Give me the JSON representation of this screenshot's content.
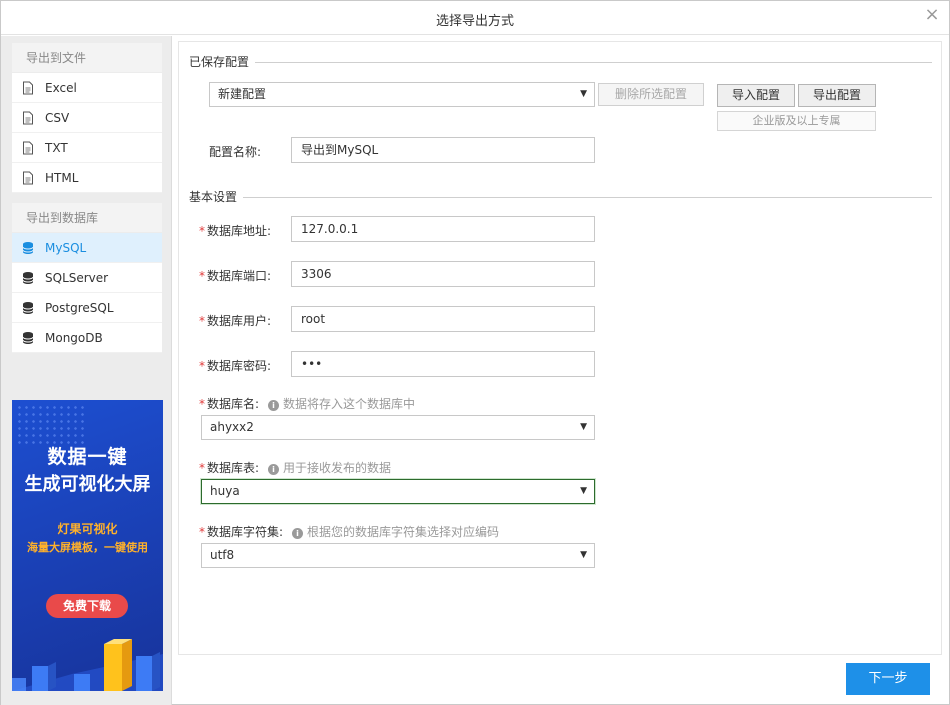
{
  "window": {
    "title": "选择导出方式",
    "close": "×"
  },
  "sidebar": {
    "file_group": {
      "heading": "导出到文件",
      "items": [
        "Excel",
        "CSV",
        "TXT",
        "HTML"
      ]
    },
    "db_group": {
      "heading": "导出到数据库",
      "items": [
        "MySQL",
        "SQLServer",
        "PostgreSQL",
        "MongoDB"
      ],
      "active": "MySQL"
    }
  },
  "ad": {
    "line1": "数据一键",
    "line2": "生成可视化大屏",
    "sub1": "灯果可视化",
    "sub2": "海量大屏模板，一键使用",
    "button": "免费下载"
  },
  "saved": {
    "heading": "已保存配置",
    "selected": "新建配置",
    "delete_label": "删除所选配置",
    "import_label": "导入配置",
    "export_label": "导出配置",
    "badge": "企业版及以上专属",
    "name_label": "配置名称:",
    "name_value": "导出到MySQL"
  },
  "basic": {
    "heading": "基本设置",
    "host": {
      "label": "数据库地址:",
      "value": "127.0.0.1"
    },
    "port": {
      "label": "数据库端口:",
      "value": "3306"
    },
    "user": {
      "label": "数据库用户:",
      "value": "root"
    },
    "password": {
      "label": "数据库密码:",
      "value": "•••"
    },
    "dbname": {
      "label": "数据库名:",
      "hint": "数据将存入这个数据库中",
      "value": "ahyxx2"
    },
    "table": {
      "label": "数据库表:",
      "hint": "用于接收发布的数据",
      "value": "huya"
    },
    "charset": {
      "label": "数据库字符集:",
      "hint": "根据您的数据库字符集选择对应编码",
      "value": "utf8"
    }
  },
  "footer": {
    "next_label": "下一步"
  },
  "colors": {
    "accent": "#1e90e8",
    "required": "#e03b3b",
    "active_bg": "#dff0fd"
  }
}
